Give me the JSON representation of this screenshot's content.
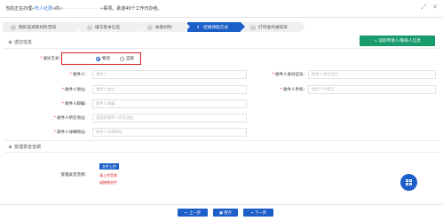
{
  "header": {
    "prefix": "当前正在办理«",
    "link": "市人社局",
    "mid": "»的«",
    "blurred": "· · · · · · · · · · · · · ·",
    "suffix": "»事项。承诺40个工作日办结。",
    "icons": [
      "expand-icon",
      "close-icon"
    ]
  },
  "steps": [
    {
      "num": "1",
      "label": "情形选择和材料告知"
    },
    {
      "num": "2",
      "label": "填写基本信息"
    },
    {
      "num": "3",
      "label": "收取材料"
    },
    {
      "num": "4",
      "label": "结果领取方式",
      "active": true
    },
    {
      "num": "5",
      "label": "打印收件通知单"
    }
  ],
  "delivery_section": {
    "title": "送达信息",
    "copy_button": "+ 读取申请人/联系人信息",
    "delivery_method": {
      "label": "送达方式:",
      "options": [
        {
          "label": "物流",
          "selected": true
        },
        {
          "label": "自取",
          "selected": false
        }
      ]
    },
    "fields": {
      "recipient": {
        "label": "收件人:",
        "placeholder": "收件人"
      },
      "recipient_id": {
        "label": "收件人身份证号:",
        "placeholder": "收件人身份证号"
      },
      "recipient_address": {
        "label": "收件人地址:",
        "placeholder": "收件人地址"
      },
      "recipient_phone": {
        "label": "收件人手机:",
        "placeholder": "收件人手机号"
      },
      "recipient_email": {
        "label": "收件人邮编:",
        "placeholder": "收件人邮编"
      },
      "recipient_region": {
        "label": "收件人所在地址:",
        "placeholder": "请选择收件人所在地址"
      },
      "recipient_detail": {
        "label": "收件人详细地址:",
        "placeholder": "收件人详细地址"
      }
    }
  },
  "audio_section": {
    "title": "受理录音音频",
    "label": "受理录音音频:",
    "upload_button": "文件上传",
    "link1": "请上传音频",
    "link2": "或拖拽文件"
  },
  "footer": {
    "prev": "← 上一步",
    "save": "▣ 暂存",
    "next": "→ 下一步"
  }
}
